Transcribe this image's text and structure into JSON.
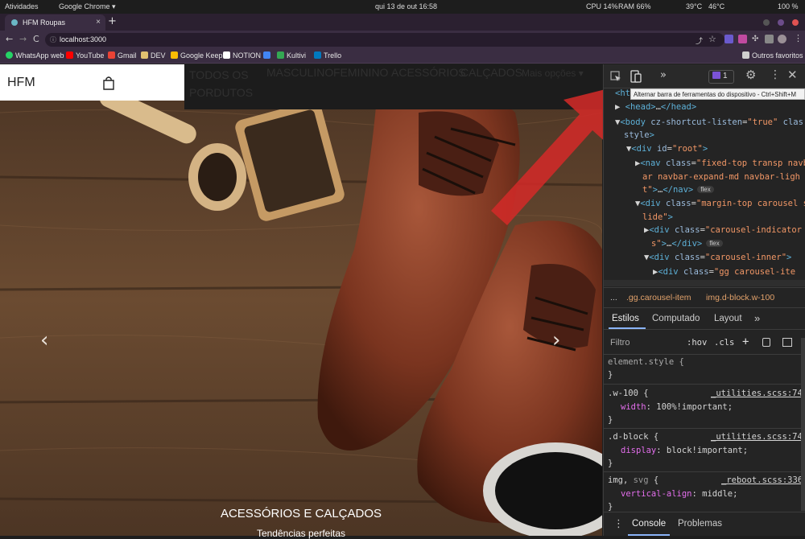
{
  "os_bar": {
    "activities": "Atividades",
    "app": "Google Chrome ▾",
    "datetime": "qui 13 de out  16:58",
    "cpu": "CPU  14%",
    "ram": "RAM  66%",
    "temp1": "39°C",
    "temp2": "46°C",
    "battery": "100 %"
  },
  "browser": {
    "tab_title": "HFM Roupas",
    "tab_close": "×",
    "new_tab": "+",
    "back": "←",
    "forward": "→",
    "reload": "C",
    "url": "localhost:3000",
    "bookmarks": [
      {
        "label": "WhatsApp web",
        "color": "#25d366"
      },
      {
        "label": "YouTube",
        "color": "#ff0000"
      },
      {
        "label": "Gmail",
        "color": "#ea4335"
      },
      {
        "label": "DEV",
        "color": "#e0c070"
      },
      {
        "label": "Google Keep",
        "color": "#fbbc04"
      },
      {
        "label": "NOTION",
        "color": "#ffffff"
      },
      {
        "label": "",
        "color": "#4285f4"
      },
      {
        "label": "Kultivi",
        "color": "#34a853"
      },
      {
        "label": "Trello",
        "color": "#0079bf"
      }
    ],
    "other_bookmarks": "Outros favoritos"
  },
  "site": {
    "logo": "HFM",
    "nav": [
      "TODOS OS PORDUTOS",
      "MASCULINO",
      "FEMININO",
      "ACESSÓRIOS",
      "CALÇADOS",
      "Mais opções ▾"
    ],
    "caption": "ACESSÓRIOS E CALÇADOS",
    "subcaption": "Tendências perfeitas",
    "prev": "‹",
    "next": "›"
  },
  "devtools": {
    "issues_count": "1",
    "more_tabs": "»",
    "tooltip": "Alternar barra de ferramentas do dispositivo - Ctrl+Shift+M",
    "breadcrumbs": [
      "...",
      ".gg.carousel-item",
      "img.d-block.w-100"
    ],
    "styles_tabs": [
      "Estilos",
      "Computado",
      "Layout",
      "»"
    ],
    "filter_placeholder": "Filtro",
    "hov": ":hov",
    "cls": ".cls",
    "drawer_tabs": [
      "Console",
      "Problemas"
    ]
  },
  "colors": {
    "tab_bar": "#2b2030",
    "toolbar": "#3a2d42",
    "devtools_bg": "#242424",
    "arrow_red": "#d02a28"
  }
}
